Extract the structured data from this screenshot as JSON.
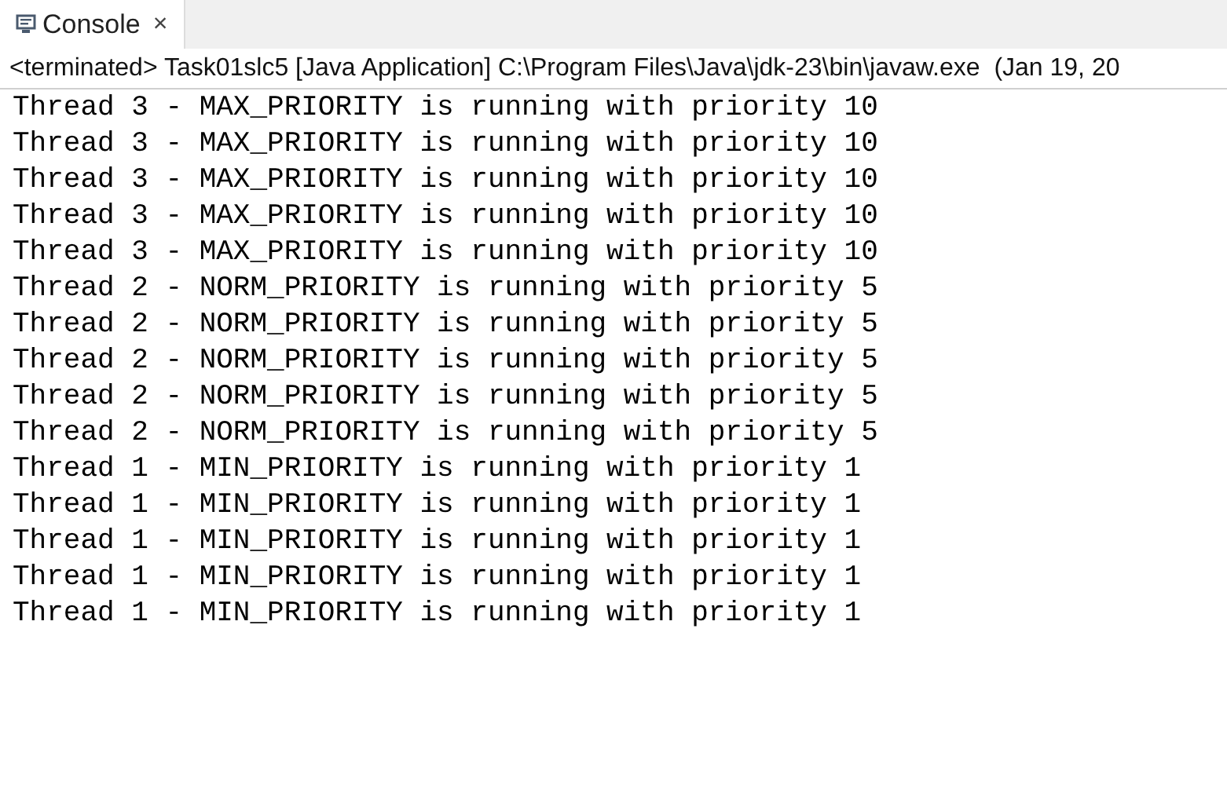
{
  "tab": {
    "label": "Console",
    "close": "×",
    "selected": true
  },
  "status": "<terminated> Task01slc5 [Java Application] C:\\Program Files\\Java\\jdk-23\\bin\\javaw.exe  (Jan 19, 20",
  "lines": [
    "Thread 3 - MAX_PRIORITY is running with priority 10",
    "Thread 3 - MAX_PRIORITY is running with priority 10",
    "Thread 3 - MAX_PRIORITY is running with priority 10",
    "Thread 3 - MAX_PRIORITY is running with priority 10",
    "Thread 3 - MAX_PRIORITY is running with priority 10",
    "Thread 2 - NORM_PRIORITY is running with priority 5",
    "Thread 2 - NORM_PRIORITY is running with priority 5",
    "Thread 2 - NORM_PRIORITY is running with priority 5",
    "Thread 2 - NORM_PRIORITY is running with priority 5",
    "Thread 2 - NORM_PRIORITY is running with priority 5",
    "Thread 1 - MIN_PRIORITY is running with priority 1",
    "Thread 1 - MIN_PRIORITY is running with priority 1",
    "Thread 1 - MIN_PRIORITY is running with priority 1",
    "Thread 1 - MIN_PRIORITY is running with priority 1",
    "Thread 1 - MIN_PRIORITY is running with priority 1"
  ]
}
